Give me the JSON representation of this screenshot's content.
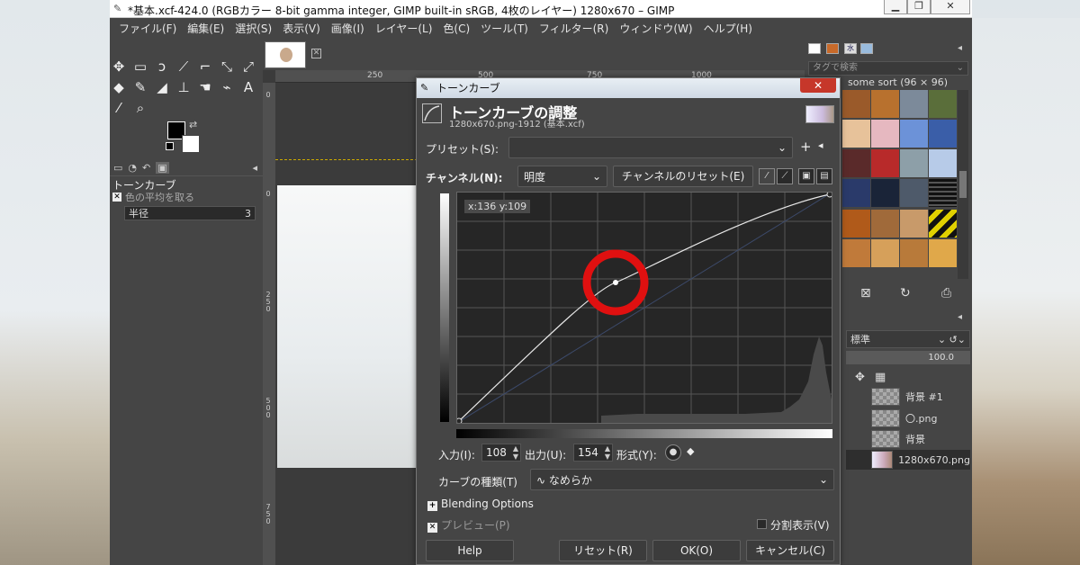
{
  "window": {
    "title": "*基本.xcf-424.0 (RGBカラー 8-bit gamma integer, GIMP built-in sRGB, 4枚のレイヤー) 1280x670 – GIMP"
  },
  "menu": [
    "ファイル(F)",
    "編集(E)",
    "選択(S)",
    "表示(V)",
    "画像(I)",
    "レイヤー(L)",
    "色(C)",
    "ツール(T)",
    "フィルター(R)",
    "ウィンドウ(W)",
    "ヘルプ(H)"
  ],
  "tool_options": {
    "title": "トーンカーブ",
    "sample_average": "色の平均を取る",
    "radius_label": "半径",
    "radius_value": "3"
  },
  "ruler": {
    "h": [
      "250",
      "500",
      "750",
      "1000"
    ],
    "v": [
      "0",
      "2 5 0",
      "5 0 0",
      "7 5 0"
    ]
  },
  "right_panel": {
    "tag_placeholder": "タグで検索",
    "sort_label": "some sort (96 × 96)",
    "mode": "標準",
    "opacity": "100.0",
    "layers": [
      "背景 #1",
      "〇.png",
      "背景",
      "1280x670.png"
    ]
  },
  "dialog": {
    "window_title": "トーンカーブ",
    "heading": "トーンカーブの調整",
    "subtitle": "1280x670.png-1912 (基本.xcf)",
    "preset_label": "プリセット(S):",
    "preset_value": "",
    "channel_label": "チャンネル(N):",
    "channel_value": "明度",
    "channel_reset": "チャンネルのリセット(E)",
    "coords": "x:136 y:109",
    "input_label": "入力(I):",
    "input_value": "108",
    "output_label": "出力(U):",
    "output_value": "154",
    "type_label": "形式(Y):",
    "curve_type_label": "カーブの種類(T)",
    "curve_type_value": "なめらか",
    "blending": "Blending Options",
    "preview": "プレビュー(P)",
    "split_view": "分割表示(V)",
    "buttons": {
      "help": "Help",
      "reset": "リセット(R)",
      "ok": "OK(O)",
      "cancel": "キャンセル(C)"
    }
  },
  "colors": {
    "highlight_ring": "#e01010",
    "panel_bg": "#454545"
  }
}
